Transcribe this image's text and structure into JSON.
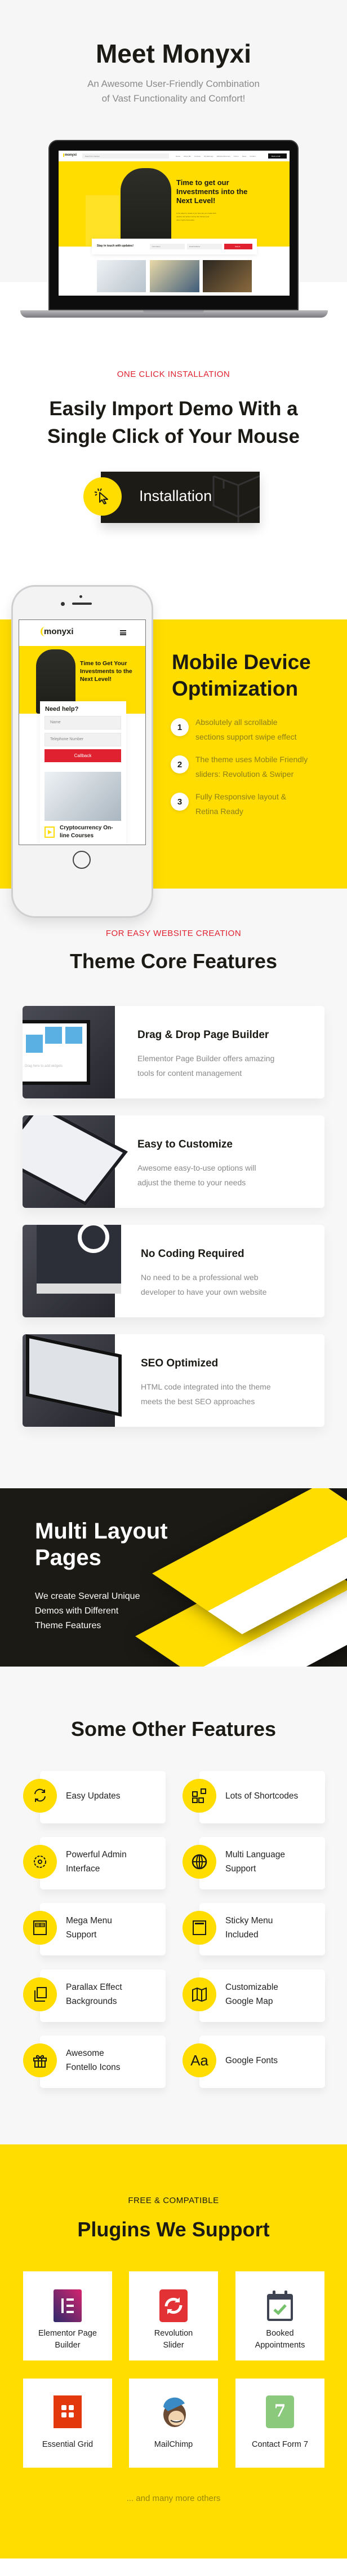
{
  "colors": {
    "yellow": "#ffdd00",
    "dark": "#1b1a15",
    "red": "#e02130",
    "light_bg": "#f7f7f7"
  },
  "hero": {
    "title": "Meet Monyxi",
    "subtitle_lines": [
      "An Awesome User-Friendly Combination",
      "of Vast Functionality and Comfort!"
    ],
    "laptop": {
      "logo": "monyxi",
      "search_placeholder": "Search for Courses",
      "nav": [
        "Home",
        "About Me",
        "Courses",
        "My Earnings",
        "Website Recovery",
        "Forum",
        "News",
        "Contact"
      ],
      "cta": "Book a Call",
      "headline_lines": [
        "Time to get our",
        "Investments into the",
        "Next Level!"
      ],
      "paragraph_lines": [
        "Is the about to reveal to you how can you create both",
        "passive and active income thru bitcoins and",
        "other Crypto Currencies"
      ],
      "subscribe_title": "Stay in touch with updates!",
      "first_name_placeholder": "First Name",
      "email_placeholder": "Email Address",
      "submit": "Submit"
    }
  },
  "install": {
    "eyebrow": "ONE CLICK INSTALLATION",
    "heading_lines": [
      "Easily Import Demo With a",
      "Single Click of Your Mouse"
    ],
    "button_label": "Installation",
    "button_icon": "cursor-click-icon"
  },
  "mobile": {
    "phone": {
      "logo": "monyxi",
      "hero_lines": [
        "Time to Get Your",
        "Investments to the",
        "Next Level!"
      ],
      "form_title": "Need help?",
      "name_placeholder": "Name",
      "phone_placeholder": "Telephone Number",
      "button": "Callback",
      "course_lines": [
        "Cryptocurrency On-",
        "line Courses"
      ]
    },
    "heading_lines": [
      "Mobile Device",
      "Optimization"
    ],
    "items": [
      {
        "num": "1",
        "lines": [
          "Absolutely all scrollable",
          "sections support swipe effect"
        ]
      },
      {
        "num": "2",
        "lines": [
          "The theme uses Mobile Friendly",
          "sliders: Revolution & Swiper"
        ]
      },
      {
        "num": "3",
        "lines": [
          "Fully Responsive layout &",
          "Retina Ready"
        ]
      }
    ]
  },
  "core": {
    "eyebrow": "FOR EASY WEBSITE CREATION",
    "title": "Theme Core Features",
    "cards": [
      {
        "title": "Drag & Drop Page Builder",
        "lines": [
          "Elementor Page Builder offers amazing",
          "tools for content management"
        ],
        "image_caption": "Drag here to add widgets"
      },
      {
        "title": "Easy to Customize",
        "lines": [
          "Awesome easy-to-use options will",
          "adjust the theme to your needs"
        ]
      },
      {
        "title": "No Coding Required",
        "lines": [
          "No need to be a professional web",
          "developer to have your own website"
        ]
      },
      {
        "title": "SEO Optimized",
        "lines": [
          "HTML code integrated into the theme",
          "meets the best SEO approaches"
        ]
      }
    ]
  },
  "multi": {
    "title_lines": [
      "Multi Layout",
      "Pages"
    ],
    "desc_lines": [
      "We create Several Unique",
      "Demos with Different",
      "Theme Features"
    ]
  },
  "other": {
    "title": "Some Other Features",
    "items": [
      {
        "icon": "refresh-icon",
        "lines": [
          "Easy Updates"
        ]
      },
      {
        "icon": "shortcodes-icon",
        "lines": [
          "Lots of Shortcodes"
        ]
      },
      {
        "icon": "gear-icon",
        "lines": [
          "Powerful Admin",
          "Interface"
        ]
      },
      {
        "icon": "globe-icon",
        "lines": [
          "Multi Language",
          "Support"
        ]
      },
      {
        "icon": "mega-menu-icon",
        "lines": [
          "Mega Menu",
          "Support"
        ]
      },
      {
        "icon": "sticky-menu-icon",
        "lines": [
          "Sticky Menu",
          "Included"
        ]
      },
      {
        "icon": "layers-icon",
        "lines": [
          "Parallax Effect",
          "Backgrounds"
        ]
      },
      {
        "icon": "map-icon",
        "lines": [
          "Customizable",
          "Google Map"
        ]
      },
      {
        "icon": "gift-icon",
        "lines": [
          "Awesome",
          "Fontello Icons"
        ]
      },
      {
        "icon": "font-icon",
        "lines": [
          "Google Fonts"
        ],
        "glyph": "Aa"
      }
    ]
  },
  "plugins": {
    "eyebrow": "FREE & COMPATIBLE",
    "title": "Plugins We Support",
    "items": [
      {
        "icon": "elementor-icon",
        "lines": [
          "Elementor Page",
          "Builder"
        ]
      },
      {
        "icon": "revolution-slider-icon",
        "lines": [
          "Revolution",
          "Slider"
        ]
      },
      {
        "icon": "calendar-check-icon",
        "lines": [
          "Booked",
          "Appointments"
        ]
      },
      {
        "icon": "essential-grid-icon",
        "lines": [
          "Essential Grid"
        ]
      },
      {
        "icon": "mailchimp-icon",
        "lines": [
          "MailChimp"
        ]
      },
      {
        "icon": "contact-form-7-icon",
        "lines": [
          "Contact Form 7"
        ],
        "glyph": "7"
      }
    ],
    "footer": "... and many more others"
  }
}
